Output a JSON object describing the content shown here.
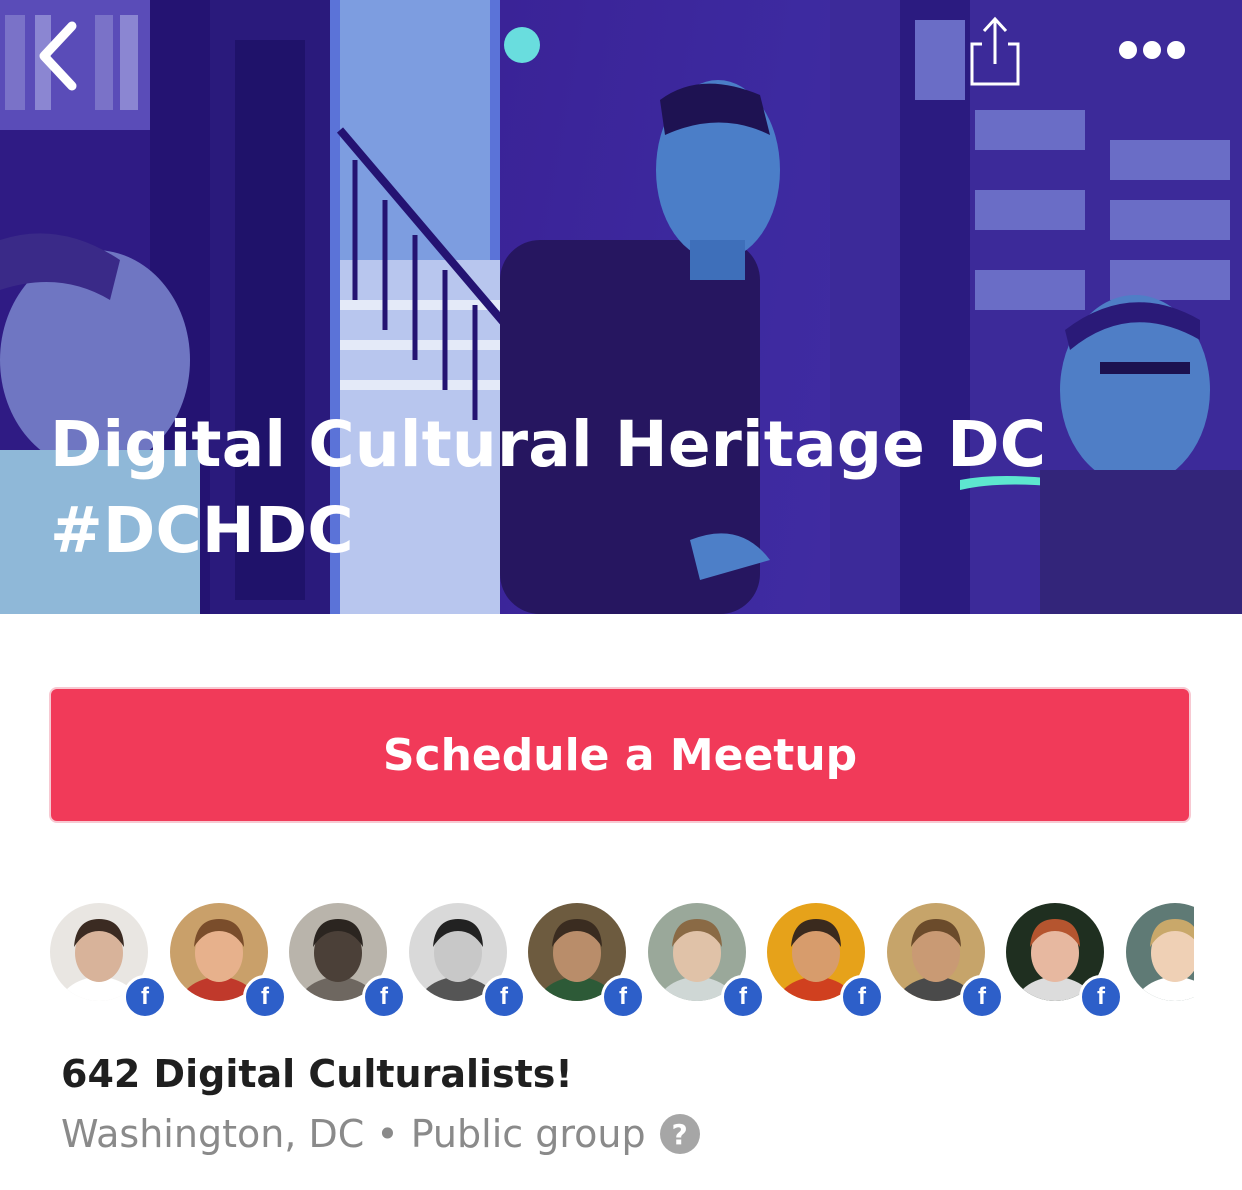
{
  "header": {
    "title_line1": "Digital Cultural Heritage DC",
    "title_line2": "#DCHDC"
  },
  "nav": {
    "back_icon": "chevron-left-icon",
    "share_icon": "share-icon",
    "more_icon": "more-dots-icon"
  },
  "cta": {
    "label": "Schedule a Meetup",
    "color": "#f13a59"
  },
  "members": {
    "badge_label": "f",
    "badge_color": "#2d5fc9",
    "avatars": [
      {
        "bg": "#e9e6e2",
        "skin": "#d8b39a",
        "hair": "#3b2b22",
        "shirt": "#ffffff",
        "badge": true
      },
      {
        "bg": "#c9a06a",
        "skin": "#e7b18c",
        "hair": "#7a4d2b",
        "shirt": "#c0392b",
        "badge": true
      },
      {
        "bg": "#b9b4ab",
        "skin": "#4b4038",
        "hair": "#2b2520",
        "shirt": "#6e6760",
        "badge": true
      },
      {
        "bg": "#d9d9d9",
        "skin": "#c8c8c8",
        "hair": "#222222",
        "shirt": "#555555",
        "badge": true
      },
      {
        "bg": "#6d5b3f",
        "skin": "#b98d6a",
        "hair": "#3a2c20",
        "shirt": "#2d5a37",
        "badge": true
      },
      {
        "bg": "#9aa89a",
        "skin": "#e0c2a8",
        "hair": "#8a6a45",
        "shirt": "#cfd7d5",
        "badge": true
      },
      {
        "bg": "#e6a21a",
        "skin": "#d79c6c",
        "hair": "#3a2a1e",
        "shirt": "#d0401f",
        "badge": true
      },
      {
        "bg": "#c6a46a",
        "skin": "#c99a74",
        "hair": "#6b4b2b",
        "shirt": "#4a4a4a",
        "badge": true
      },
      {
        "bg": "#1f2f20",
        "skin": "#e7b8a0",
        "hair": "#b5552f",
        "shirt": "#dcdcdc",
        "badge": true
      },
      {
        "bg": "#5f7a75",
        "skin": "#efd0b5",
        "hair": "#c9a86a",
        "shirt": "#ffffff",
        "badge": false
      }
    ]
  },
  "group": {
    "member_count_text": "642 Digital Culturalists!",
    "location": "Washington, DC",
    "separator": "•",
    "visibility": "Public group",
    "help_icon": "help-question-icon",
    "help_glyph": "?"
  }
}
